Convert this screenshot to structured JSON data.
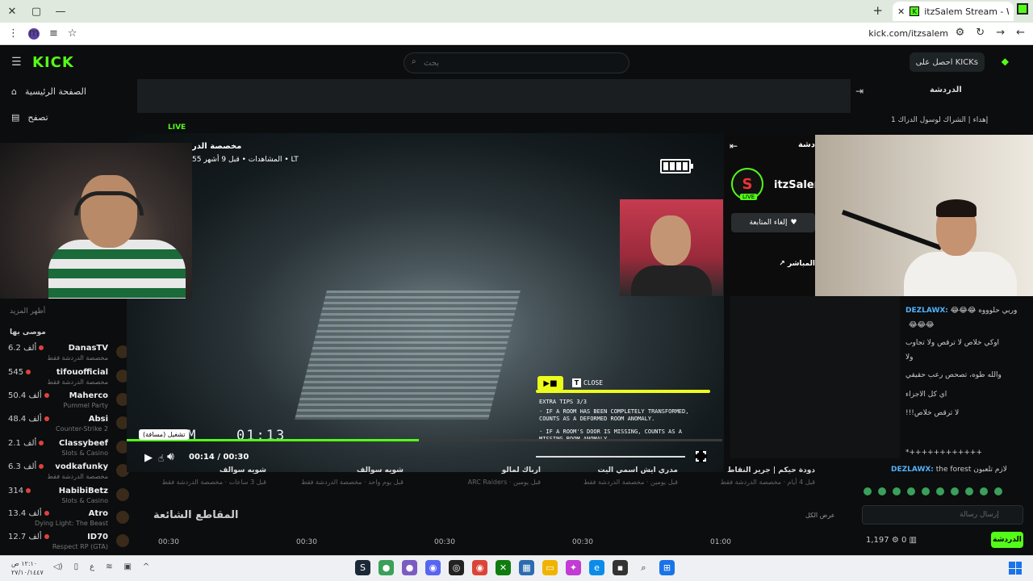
{
  "browser": {
    "tab_title": "itzSalem Stream - Watch Li",
    "tab_favicon": "K",
    "window_controls": [
      "—",
      "▢",
      "✕"
    ],
    "url": "kick.com/itzsalem",
    "profile_initial": "m"
  },
  "kick": {
    "logo": "KICK",
    "search_placeholder": "بحث",
    "get_kicks": "احصل على KICKs",
    "sidebar": {
      "nav": [
        {
          "label": "الصفحة الرئيسية",
          "icon": "home-icon"
        },
        {
          "label": "تصفح",
          "icon": "browse-icon"
        }
      ],
      "recommended_title": "موصى بها",
      "more_title": "أظهر المزيد",
      "channels": [
        {
          "name": "DanasTV",
          "viewers": "6.2 ألف",
          "category": "مخصصة الدردشة فقط"
        },
        {
          "name": "tifouofficial",
          "viewers": "545",
          "category": "مخصصة الدردشة فقط"
        },
        {
          "name": "Maherco",
          "viewers": "50.4 ألف",
          "category": "Pummel Party"
        },
        {
          "name": "Absi",
          "viewers": "48.4 ألف",
          "category": "Counter-Strike 2"
        },
        {
          "name": "Classybeef",
          "viewers": "2.1 ألف",
          "category": "Slots & Casino"
        },
        {
          "name": "vodkafunky",
          "viewers": "6.3 ألف",
          "category": "مخصصة الدردشة فقط"
        },
        {
          "name": "HabibiBetz",
          "viewers": "314",
          "category": "Slots & Casino"
        },
        {
          "name": "Atro",
          "viewers": "13.4 ألف",
          "category": "Dying Light: The Beast"
        },
        {
          "name": "ID70",
          "viewers": "12.7 ألف",
          "category": "Respect RP (GTA)"
        }
      ]
    },
    "player": {
      "live_badge": "LIVE",
      "stream_title": "مخصصة الدر",
      "stream_meta": "المشاهدات • قبل 9 أشهر 55 • LT",
      "hud_room": "OM",
      "hud_time": "01:13",
      "tips": {
        "close_key": "T",
        "close_label": "CLOSE",
        "heading": "EXTRA TIPS 3/3",
        "tip1": "· IF A ROOM HAS BEEN COMPLETELY TRANSFORMED, COUNTS AS A DEFORMED ROOM ANOMALY.",
        "tip2": "· IF A ROOM'S DOOR IS MISSING, COUNTS AS A MISSING ROOM ANOMALY."
      },
      "tooltip": "تشغيل (مسافة)",
      "time_display": "00:14 / 00:30",
      "progress": 0.49
    },
    "channel_panel": {
      "chat_label": "دشة",
      "streamer": "itzSalem",
      "live_tag": "LIVE",
      "unfollow": "إلغاء المتابعة",
      "go_live": "المباشر"
    },
    "chat": {
      "title": "الدردشة",
      "messages": [
        {
          "user": "",
          "text": "إهداء | الشراك لوسول الدراك 1"
        },
        {
          "user": "DEZLAWX:",
          "text": "😂😂😂 وربي حلوووه"
        },
        {
          "user": "",
          "text": "😂😂😂"
        },
        {
          "user": "",
          "text": "اوكي خلاص لا ترقص ولا تجاوب"
        },
        {
          "user": "",
          "text": "ولا"
        },
        {
          "user": "",
          "text": "والله طوه، تصحص رعب حقيقي"
        },
        {
          "user": "",
          "text": "اي كل الاجزاء"
        },
        {
          "user": "",
          "text": "!!!لا ترقص خلاص"
        },
        {
          "user": "",
          "text": "*++++++++++++"
        },
        {
          "user": "DEZLAWX:",
          "text": "the forest لازم تلعبون"
        }
      ],
      "input_placeholder": "إرسال رسالة",
      "points": "1,197",
      "count": "0",
      "send": "الدردشة"
    },
    "clips_row": [
      {
        "title": "شويه سوالف",
        "sub": "قبل 3 ساعات · مخصصة الدردشة فقط"
      },
      {
        "title": "شويه سوالف",
        "sub": "قبل يوم واحد · مخصصة الدردشة فقط"
      },
      {
        "title": "ارباك لمالو",
        "sub": "ARC Raiders · قبل يومين"
      },
      {
        "title": "مدري ايش اسمي اليت",
        "sub": "قبل يومين · مخصصة الدردشة فقط"
      },
      {
        "title": "دودة حيكم | جرير النقاط",
        "sub": "قبل 4 أيام · مخصصة الدردشة فقط"
      }
    ],
    "trending_title": "المقاطع الشائعة",
    "see_all": "عرض الكل",
    "durations": [
      "00:30",
      "00:30",
      "00:30",
      "00:30",
      "01:00"
    ]
  },
  "taskbar": {
    "clock_time": "١٢:١٠ ص",
    "clock_date": "٢٧/١٠/١٤٤٧",
    "apps": [
      "steam",
      "chrome-green",
      "chrome-purple",
      "discord",
      "obs",
      "chrome",
      "xbox",
      "files",
      "explorer",
      "copilot",
      "edge",
      "app",
      "search",
      "windows"
    ]
  }
}
